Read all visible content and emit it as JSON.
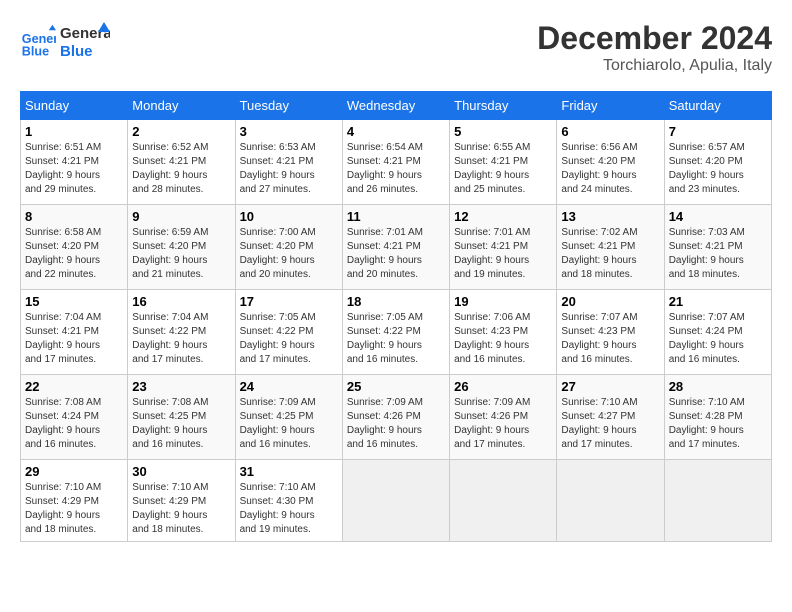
{
  "header": {
    "logo_line1": "General",
    "logo_line2": "Blue",
    "title": "December 2024",
    "subtitle": "Torchiarolo, Apulia, Italy"
  },
  "calendar": {
    "weekdays": [
      "Sunday",
      "Monday",
      "Tuesday",
      "Wednesday",
      "Thursday",
      "Friday",
      "Saturday"
    ],
    "weeks": [
      [
        {
          "day": "1",
          "info": "Sunrise: 6:51 AM\nSunset: 4:21 PM\nDaylight: 9 hours\nand 29 minutes."
        },
        {
          "day": "2",
          "info": "Sunrise: 6:52 AM\nSunset: 4:21 PM\nDaylight: 9 hours\nand 28 minutes."
        },
        {
          "day": "3",
          "info": "Sunrise: 6:53 AM\nSunset: 4:21 PM\nDaylight: 9 hours\nand 27 minutes."
        },
        {
          "day": "4",
          "info": "Sunrise: 6:54 AM\nSunset: 4:21 PM\nDaylight: 9 hours\nand 26 minutes."
        },
        {
          "day": "5",
          "info": "Sunrise: 6:55 AM\nSunset: 4:21 PM\nDaylight: 9 hours\nand 25 minutes."
        },
        {
          "day": "6",
          "info": "Sunrise: 6:56 AM\nSunset: 4:20 PM\nDaylight: 9 hours\nand 24 minutes."
        },
        {
          "day": "7",
          "info": "Sunrise: 6:57 AM\nSunset: 4:20 PM\nDaylight: 9 hours\nand 23 minutes."
        }
      ],
      [
        {
          "day": "8",
          "info": "Sunrise: 6:58 AM\nSunset: 4:20 PM\nDaylight: 9 hours\nand 22 minutes."
        },
        {
          "day": "9",
          "info": "Sunrise: 6:59 AM\nSunset: 4:20 PM\nDaylight: 9 hours\nand 21 minutes."
        },
        {
          "day": "10",
          "info": "Sunrise: 7:00 AM\nSunset: 4:20 PM\nDaylight: 9 hours\nand 20 minutes."
        },
        {
          "day": "11",
          "info": "Sunrise: 7:01 AM\nSunset: 4:21 PM\nDaylight: 9 hours\nand 20 minutes."
        },
        {
          "day": "12",
          "info": "Sunrise: 7:01 AM\nSunset: 4:21 PM\nDaylight: 9 hours\nand 19 minutes."
        },
        {
          "day": "13",
          "info": "Sunrise: 7:02 AM\nSunset: 4:21 PM\nDaylight: 9 hours\nand 18 minutes."
        },
        {
          "day": "14",
          "info": "Sunrise: 7:03 AM\nSunset: 4:21 PM\nDaylight: 9 hours\nand 18 minutes."
        }
      ],
      [
        {
          "day": "15",
          "info": "Sunrise: 7:04 AM\nSunset: 4:21 PM\nDaylight: 9 hours\nand 17 minutes."
        },
        {
          "day": "16",
          "info": "Sunrise: 7:04 AM\nSunset: 4:22 PM\nDaylight: 9 hours\nand 17 minutes."
        },
        {
          "day": "17",
          "info": "Sunrise: 7:05 AM\nSunset: 4:22 PM\nDaylight: 9 hours\nand 17 minutes."
        },
        {
          "day": "18",
          "info": "Sunrise: 7:05 AM\nSunset: 4:22 PM\nDaylight: 9 hours\nand 16 minutes."
        },
        {
          "day": "19",
          "info": "Sunrise: 7:06 AM\nSunset: 4:23 PM\nDaylight: 9 hours\nand 16 minutes."
        },
        {
          "day": "20",
          "info": "Sunrise: 7:07 AM\nSunset: 4:23 PM\nDaylight: 9 hours\nand 16 minutes."
        },
        {
          "day": "21",
          "info": "Sunrise: 7:07 AM\nSunset: 4:24 PM\nDaylight: 9 hours\nand 16 minutes."
        }
      ],
      [
        {
          "day": "22",
          "info": "Sunrise: 7:08 AM\nSunset: 4:24 PM\nDaylight: 9 hours\nand 16 minutes."
        },
        {
          "day": "23",
          "info": "Sunrise: 7:08 AM\nSunset: 4:25 PM\nDaylight: 9 hours\nand 16 minutes."
        },
        {
          "day": "24",
          "info": "Sunrise: 7:09 AM\nSunset: 4:25 PM\nDaylight: 9 hours\nand 16 minutes."
        },
        {
          "day": "25",
          "info": "Sunrise: 7:09 AM\nSunset: 4:26 PM\nDaylight: 9 hours\nand 16 minutes."
        },
        {
          "day": "26",
          "info": "Sunrise: 7:09 AM\nSunset: 4:26 PM\nDaylight: 9 hours\nand 17 minutes."
        },
        {
          "day": "27",
          "info": "Sunrise: 7:10 AM\nSunset: 4:27 PM\nDaylight: 9 hours\nand 17 minutes."
        },
        {
          "day": "28",
          "info": "Sunrise: 7:10 AM\nSunset: 4:28 PM\nDaylight: 9 hours\nand 17 minutes."
        }
      ],
      [
        {
          "day": "29",
          "info": "Sunrise: 7:10 AM\nSunset: 4:29 PM\nDaylight: 9 hours\nand 18 minutes."
        },
        {
          "day": "30",
          "info": "Sunrise: 7:10 AM\nSunset: 4:29 PM\nDaylight: 9 hours\nand 18 minutes."
        },
        {
          "day": "31",
          "info": "Sunrise: 7:10 AM\nSunset: 4:30 PM\nDaylight: 9 hours\nand 19 minutes."
        },
        {
          "day": "",
          "info": ""
        },
        {
          "day": "",
          "info": ""
        },
        {
          "day": "",
          "info": ""
        },
        {
          "day": "",
          "info": ""
        }
      ]
    ]
  }
}
